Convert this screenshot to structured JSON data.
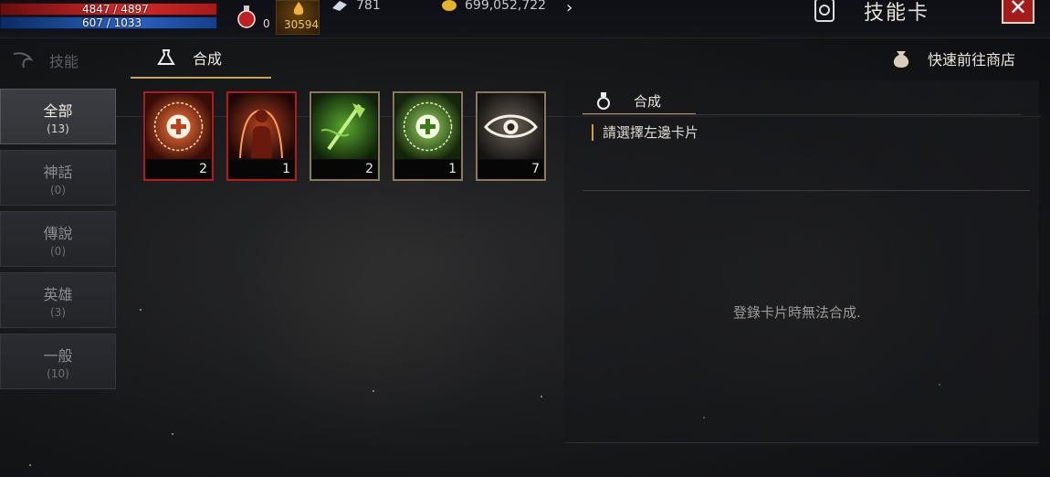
{
  "topbar": {
    "hp_text": "4847 / 4897",
    "mp_text": "607 / 1033",
    "potion_count": "0",
    "elixir_count": "30594",
    "crystal": "781",
    "gold": "699,052,722",
    "title": "技能卡",
    "close_icon": "close-icon"
  },
  "tabs": {
    "skill_label": "技能",
    "compose_label": "合成",
    "shop_label": "快速前往商店"
  },
  "sidebar": {
    "items": [
      {
        "name": "全部",
        "count": "(13)",
        "active": true
      },
      {
        "name": "神話",
        "count": "(0)"
      },
      {
        "name": "傳說",
        "count": "(0)"
      },
      {
        "name": "英雄",
        "count": "(3)"
      },
      {
        "name": "一般",
        "count": "(10)"
      }
    ]
  },
  "cards": [
    {
      "icon": "heal-rune-icon",
      "count": "2",
      "frame_color": "#b41c1c"
    },
    {
      "icon": "body-aura-icon",
      "count": "1",
      "frame_color": "#b41c1c"
    },
    {
      "icon": "green-weapon-icon",
      "count": "2",
      "frame_color": "#8a7a5a"
    },
    {
      "icon": "green-rune-icon",
      "count": "1",
      "frame_color": "#8a7a5a"
    },
    {
      "icon": "eye-icon",
      "count": "7",
      "frame_color": "#8a7a5a"
    }
  ],
  "panel": {
    "tab_label": "合成",
    "hint": "請選擇左邊卡片",
    "message": "登錄卡片時無法合成."
  }
}
